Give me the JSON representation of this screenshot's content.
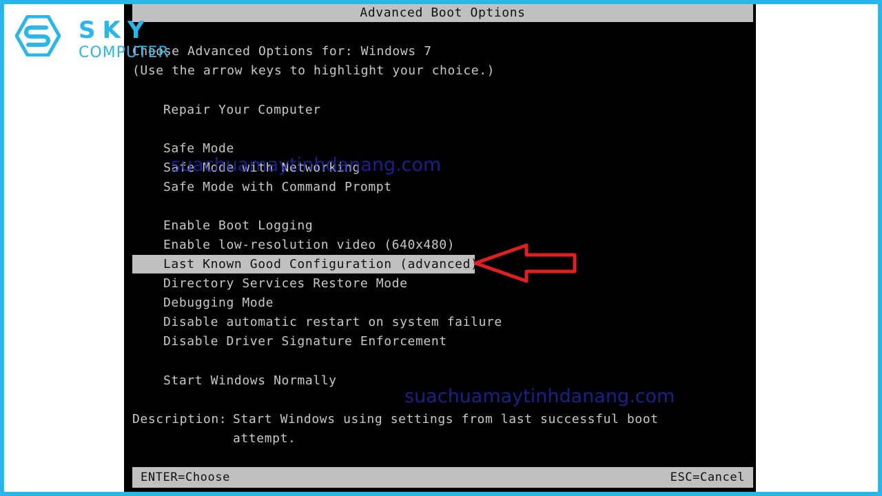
{
  "logo": {
    "name": "SKY",
    "subtitle": "COMPUTER"
  },
  "screen": {
    "title": "Advanced Boot Options",
    "choose_line": "Choose Advanced Options for: Windows 7",
    "hint_line": "(Use the arrow keys to highlight your choice.)",
    "options": [
      "Repair Your Computer",
      "Safe Mode",
      "Safe Mode with Networking",
      "Safe Mode with Command Prompt",
      "Enable Boot Logging",
      "Enable low-resolution video (640x480)",
      "Last Known Good Configuration (advanced)",
      "Directory Services Restore Mode",
      "Debugging Mode",
      "Disable automatic restart on system failure",
      "Disable Driver Signature Enforcement",
      "Start Windows Normally"
    ],
    "selected_index": 6,
    "description_label": "Description:",
    "description_text": "Start Windows using settings from last successful boot attempt.",
    "footer_left": "ENTER=Choose",
    "footer_right": "ESC=Cancel"
  },
  "watermarks": [
    "suachuamaytinhdanang.com",
    "suachuamaytinhdanang.com"
  ],
  "colors": {
    "frame": "#29b6e8",
    "highlight": "#c0c0c0",
    "arrow": "#e02020",
    "watermark": "#1d2fb8"
  }
}
